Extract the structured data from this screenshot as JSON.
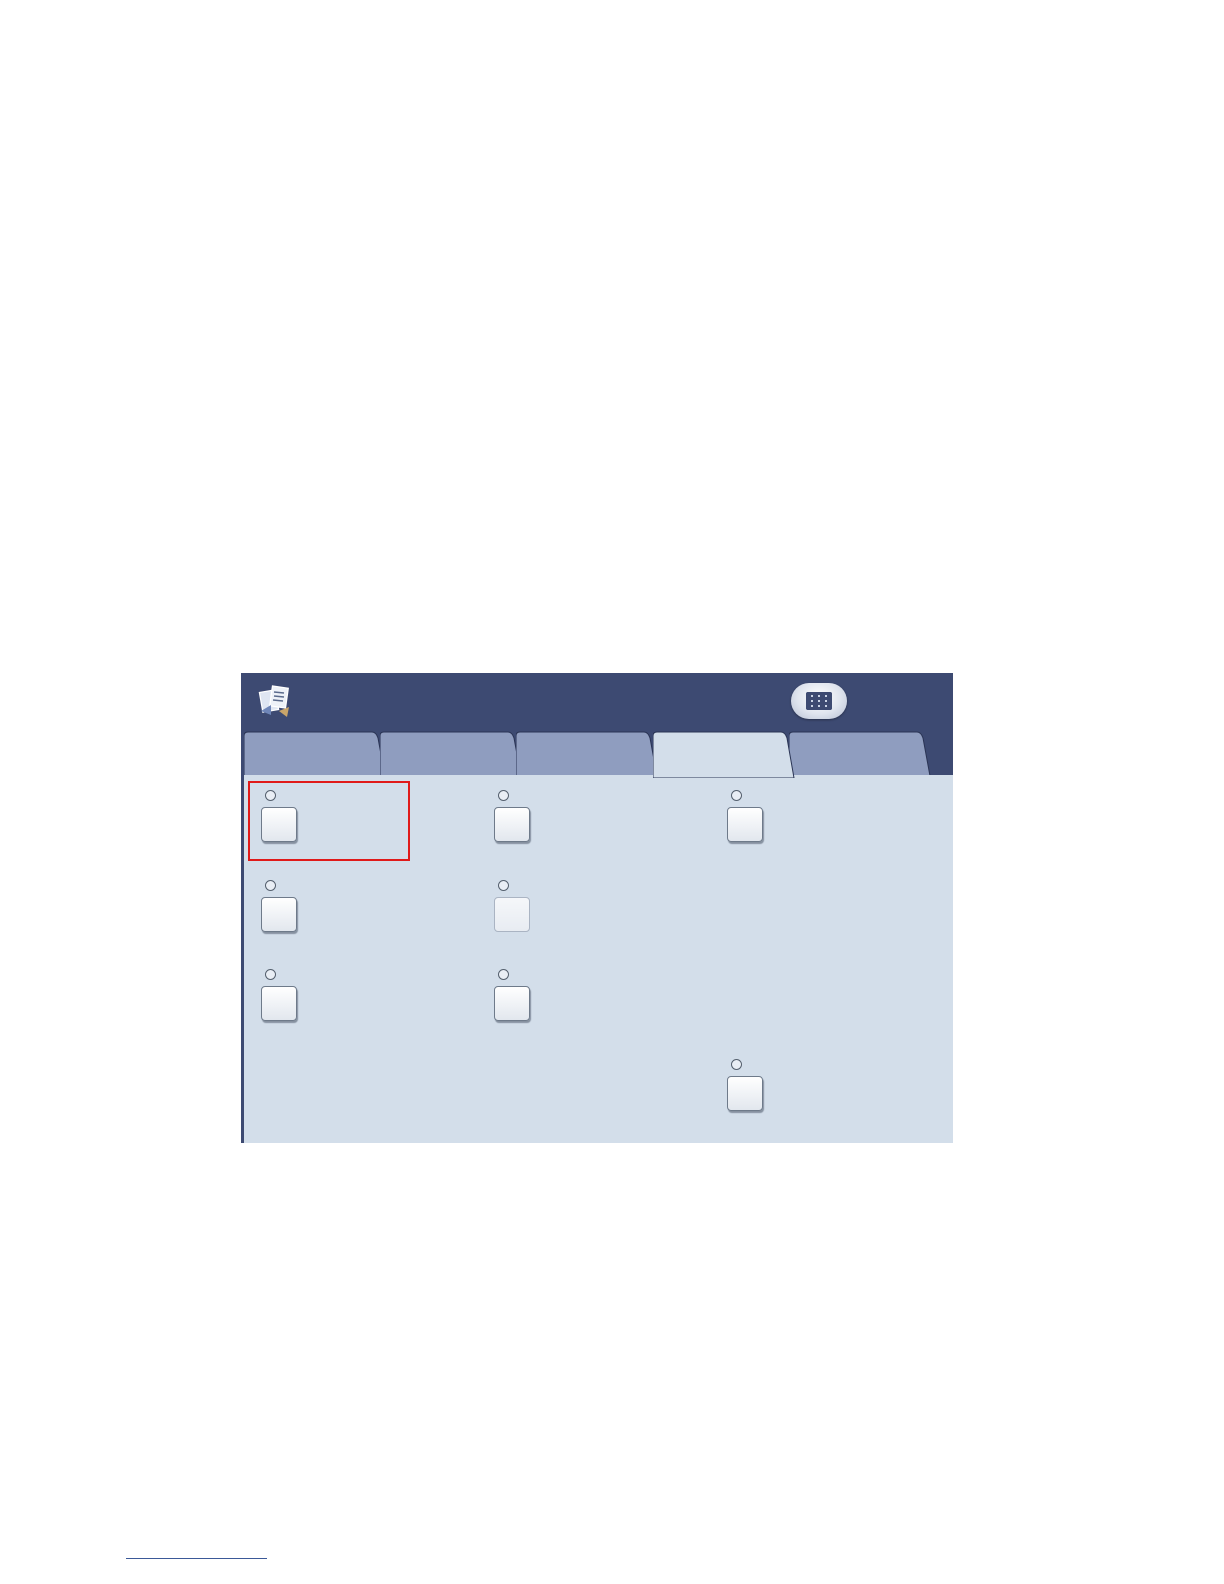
{
  "colors": {
    "header_bar": "#3d4a72",
    "panel_background": "#d3deea",
    "active_tab": "#d3deea",
    "inactive_tab": "#8f9dbf",
    "highlight_border": "#e01a1a"
  },
  "header": {
    "app_icon": "copy-app-icon",
    "keypad_icon": "keypad-icon"
  },
  "tabs": [
    {
      "label": "",
      "active": false
    },
    {
      "label": "",
      "active": false
    },
    {
      "label": "",
      "active": false
    },
    {
      "label": "",
      "active": true
    },
    {
      "label": "",
      "active": false
    }
  ],
  "options": [
    {
      "label": "",
      "selected": false,
      "enabled": true,
      "highlighted": true
    },
    {
      "label": "",
      "selected": false,
      "enabled": true,
      "highlighted": false
    },
    {
      "label": "",
      "selected": false,
      "enabled": true,
      "highlighted": false
    },
    {
      "label": "",
      "selected": false,
      "enabled": true,
      "highlighted": false
    },
    {
      "label": "",
      "selected": false,
      "enabled": false,
      "highlighted": false
    },
    {
      "label": "",
      "selected": false,
      "enabled": true,
      "highlighted": false
    },
    {
      "label": "",
      "selected": false,
      "enabled": true,
      "highlighted": false
    },
    {
      "label": "",
      "selected": false,
      "enabled": true,
      "highlighted": false
    }
  ]
}
